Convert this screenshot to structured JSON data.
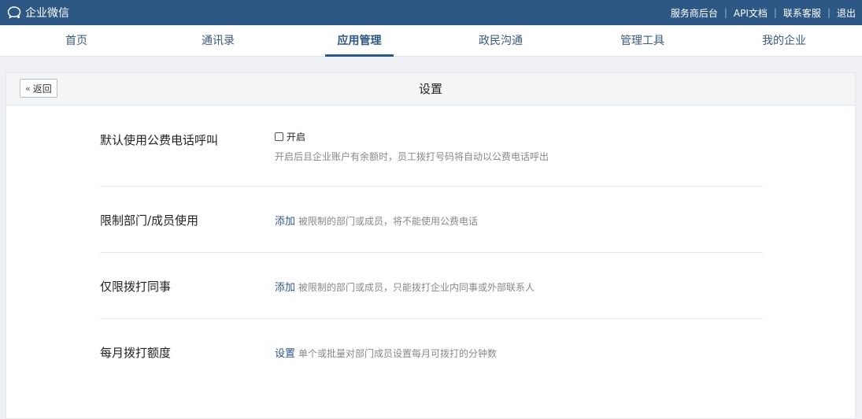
{
  "topbar": {
    "brand": "企业微信",
    "links": [
      "服务商后台",
      "API文档",
      "联系客服",
      "退出"
    ]
  },
  "nav": {
    "items": [
      "首页",
      "通讯录",
      "应用管理",
      "政民沟通",
      "管理工具",
      "我的企业"
    ],
    "active_index": 2
  },
  "panel": {
    "back_label": "返回",
    "title": "设置"
  },
  "settings": {
    "public_call": {
      "label": "默认使用公费电话呼叫",
      "checkbox_label": "开启",
      "checked": false,
      "hint": "开启后且企业账户有余额时，员工拨打号码将自动以公费电话呼出"
    },
    "restrict_usage": {
      "label": "限制部门/成员使用",
      "action": "添加",
      "hint": "被限制的部门或成员，将不能使用公费电话"
    },
    "colleagues_only": {
      "label": "仅限拨打同事",
      "action": "添加",
      "hint": "被限制的部门或成员，只能拨打企业内同事或外部联系人"
    },
    "monthly_quota": {
      "label": "每月拨打额度",
      "action": "设置",
      "hint": "单个或批量对部门成员设置每月可拨打的分钟数"
    }
  },
  "colors": {
    "brand": "#2d5784",
    "link": "#2d5784",
    "hint": "#888888"
  }
}
